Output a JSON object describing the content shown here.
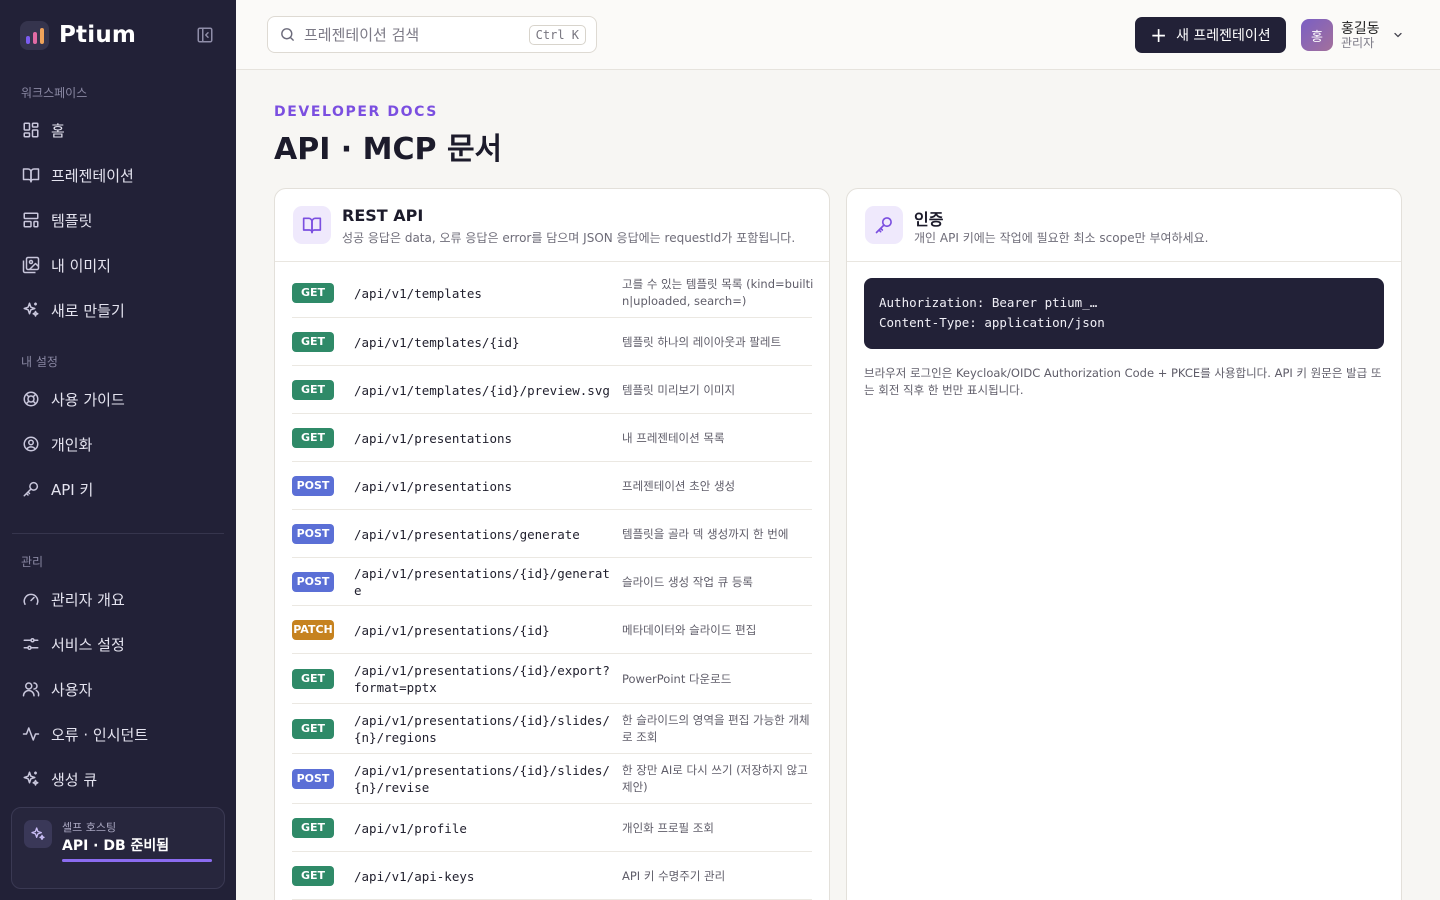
{
  "app": {
    "name": "Ptium",
    "logo_bars": [
      "#7b5cf0",
      "#e26ba4",
      "#f0a35a"
    ]
  },
  "sidebar": {
    "sections": [
      {
        "label": "워크스페이스",
        "items": [
          {
            "label": "홈",
            "icon": "home-grid-icon"
          },
          {
            "label": "프레젠테이션",
            "icon": "book-open-icon"
          },
          {
            "label": "템플릿",
            "icon": "layout-template-icon"
          },
          {
            "label": "내 이미지",
            "icon": "image-icon"
          },
          {
            "label": "새로 만들기",
            "icon": "sparkles-icon"
          }
        ]
      },
      {
        "label": "내 설정",
        "items": [
          {
            "label": "사용 가이드",
            "icon": "life-buoy-icon"
          },
          {
            "label": "개인화",
            "icon": "user-circle-icon"
          },
          {
            "label": "API 키",
            "icon": "key-icon"
          }
        ]
      },
      {
        "label": "관리",
        "items": [
          {
            "label": "관리자 개요",
            "icon": "gauge-icon"
          },
          {
            "label": "서비스 설정",
            "icon": "sliders-icon"
          },
          {
            "label": "사용자",
            "icon": "users-icon"
          },
          {
            "label": "오류 · 인시던트",
            "icon": "activity-icon"
          },
          {
            "label": "생성 큐",
            "icon": "sparkles-icon"
          }
        ]
      }
    ],
    "status": {
      "subtitle": "셀프 호스팅",
      "title": "API · DB 준비됨",
      "progress": 1.0,
      "accent": "#8b6cf0"
    }
  },
  "header": {
    "search_placeholder": "프레젠테이션 검색",
    "search_shortcut": "Ctrl K",
    "new_button_label": "새 프레젠테이션",
    "user": {
      "initial": "홍",
      "name": "홍길동",
      "role": "관리자"
    }
  },
  "page": {
    "eyebrow": "DEVELOPER DOCS",
    "title": "API · MCP 문서"
  },
  "rest": {
    "title": "REST API",
    "description": "성공 응답은 data, 오류 응답은 error를 담으며 JSON 응답에는 requestId가 포함됩니다.",
    "method_colors": {
      "GET": "#2f8a68",
      "POST": "#5b6fd6",
      "PATCH": "#c6821f"
    },
    "endpoints": [
      {
        "method": "GET",
        "path": "/api/v1/templates",
        "desc": "고를 수 있는 템플릿 목록 (kind=builtin|uploaded, search=)"
      },
      {
        "method": "GET",
        "path": "/api/v1/templates/{id}",
        "desc": "템플릿 하나의 레이아웃과 팔레트"
      },
      {
        "method": "GET",
        "path": "/api/v1/templates/{id}/preview.svg",
        "desc": "템플릿 미리보기 이미지"
      },
      {
        "method": "GET",
        "path": "/api/v1/presentations",
        "desc": "내 프레젠테이션 목록"
      },
      {
        "method": "POST",
        "path": "/api/v1/presentations",
        "desc": "프레젠테이션 초안 생성"
      },
      {
        "method": "POST",
        "path": "/api/v1/presentations/generate",
        "desc": "템플릿을 골라 덱 생성까지 한 번에"
      },
      {
        "method": "POST",
        "path": "/api/v1/presentations/{id}/generate",
        "desc": "슬라이드 생성 작업 큐 등록"
      },
      {
        "method": "PATCH",
        "path": "/api/v1/presentations/{id}",
        "desc": "메타데이터와 슬라이드 편집"
      },
      {
        "method": "GET",
        "path": "/api/v1/presentations/{id}/export?format=pptx",
        "desc": "PowerPoint 다운로드"
      },
      {
        "method": "GET",
        "path": "/api/v1/presentations/{id}/slides/{n}/regions",
        "desc": "한 슬라이드의 영역을 편집 가능한 개체로 조회"
      },
      {
        "method": "POST",
        "path": "/api/v1/presentations/{id}/slides/{n}/revise",
        "desc": "한 장만 AI로 다시 쓰기 (저장하지 않고 제안)"
      },
      {
        "method": "GET",
        "path": "/api/v1/profile",
        "desc": "개인화 프로필 조회"
      },
      {
        "method": "GET",
        "path": "/api/v1/api-keys",
        "desc": "API 키 수명주기 관리"
      }
    ]
  },
  "auth": {
    "title": "인증",
    "description": "개인 API 키에는 작업에 필요한 최소 scope만 부여하세요.",
    "code_lines": [
      "Authorization: Bearer ptium_…",
      "Content-Type: application/json"
    ],
    "note": "브라우저 로그인은 Keycloak/OIDC Authorization Code + PKCE를 사용합니다. API 키 원문은 발급 또는 회전 직후 한 번만 표시됩니다."
  }
}
